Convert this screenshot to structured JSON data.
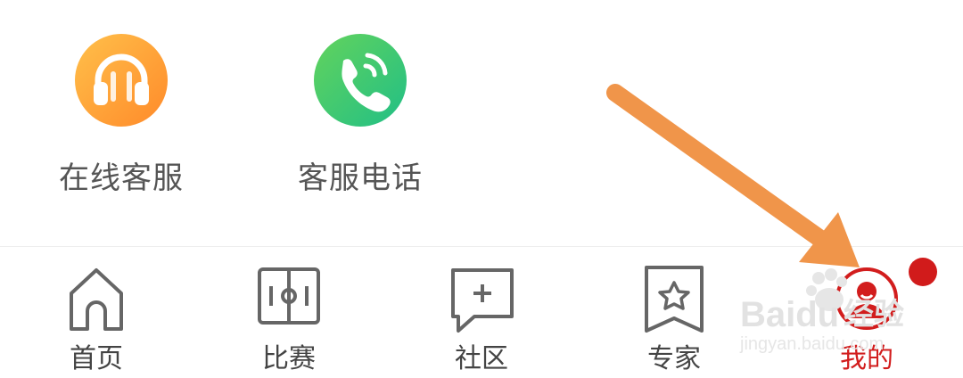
{
  "services": [
    {
      "label": "在线客服",
      "icon": "headset-icon",
      "color": "#ff9f36"
    },
    {
      "label": "客服电话",
      "icon": "phone-icon",
      "color": "#3cc86f"
    }
  ],
  "nav": {
    "home": {
      "label": "首页",
      "icon": "home-icon"
    },
    "match": {
      "label": "比赛",
      "icon": "field-icon"
    },
    "community": {
      "label": "社区",
      "icon": "chat-plus-icon"
    },
    "expert": {
      "label": "专家",
      "icon": "star-bookmark-icon"
    },
    "mine": {
      "label": "我的",
      "icon": "user-icon",
      "active": true
    }
  },
  "watermark": {
    "brand": "Baidu",
    "cn": "经验",
    "url": "jingyan.baidu.com"
  },
  "colors": {
    "active": "#d21d1d",
    "arrow": "#f0954a",
    "text": "#555555"
  }
}
